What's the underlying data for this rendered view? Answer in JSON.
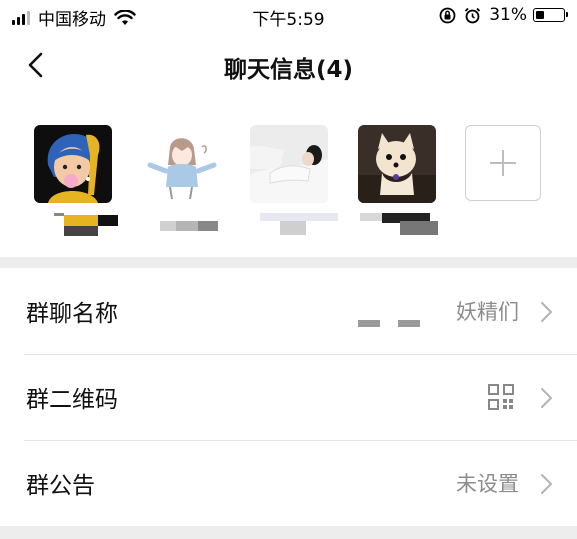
{
  "status_bar": {
    "carrier": "中国移动",
    "time": "下午5:59",
    "battery_percent": "31%",
    "battery_level": 0.31
  },
  "nav": {
    "title": "聊天信息(4)",
    "back_icon": "chevron-left-icon"
  },
  "members": [
    {
      "avatar": "girl-with-pearl-earring-cartoon"
    },
    {
      "avatar": "anime-girl-sketch"
    },
    {
      "avatar": "sleeping-girl-photo"
    },
    {
      "avatar": "pomeranian-puppy-photo"
    }
  ],
  "add_member_icon": "plus-icon",
  "settings": {
    "group_name": {
      "label": "群聊名称",
      "value": "妖精们"
    },
    "group_qr": {
      "label": "群二维码",
      "icon": "qr-code-icon"
    },
    "group_notice": {
      "label": "群公告",
      "value": "未设置"
    }
  },
  "colors": {
    "background": "#ededed",
    "card": "#ffffff",
    "secondary_text": "#8c8c8c"
  }
}
